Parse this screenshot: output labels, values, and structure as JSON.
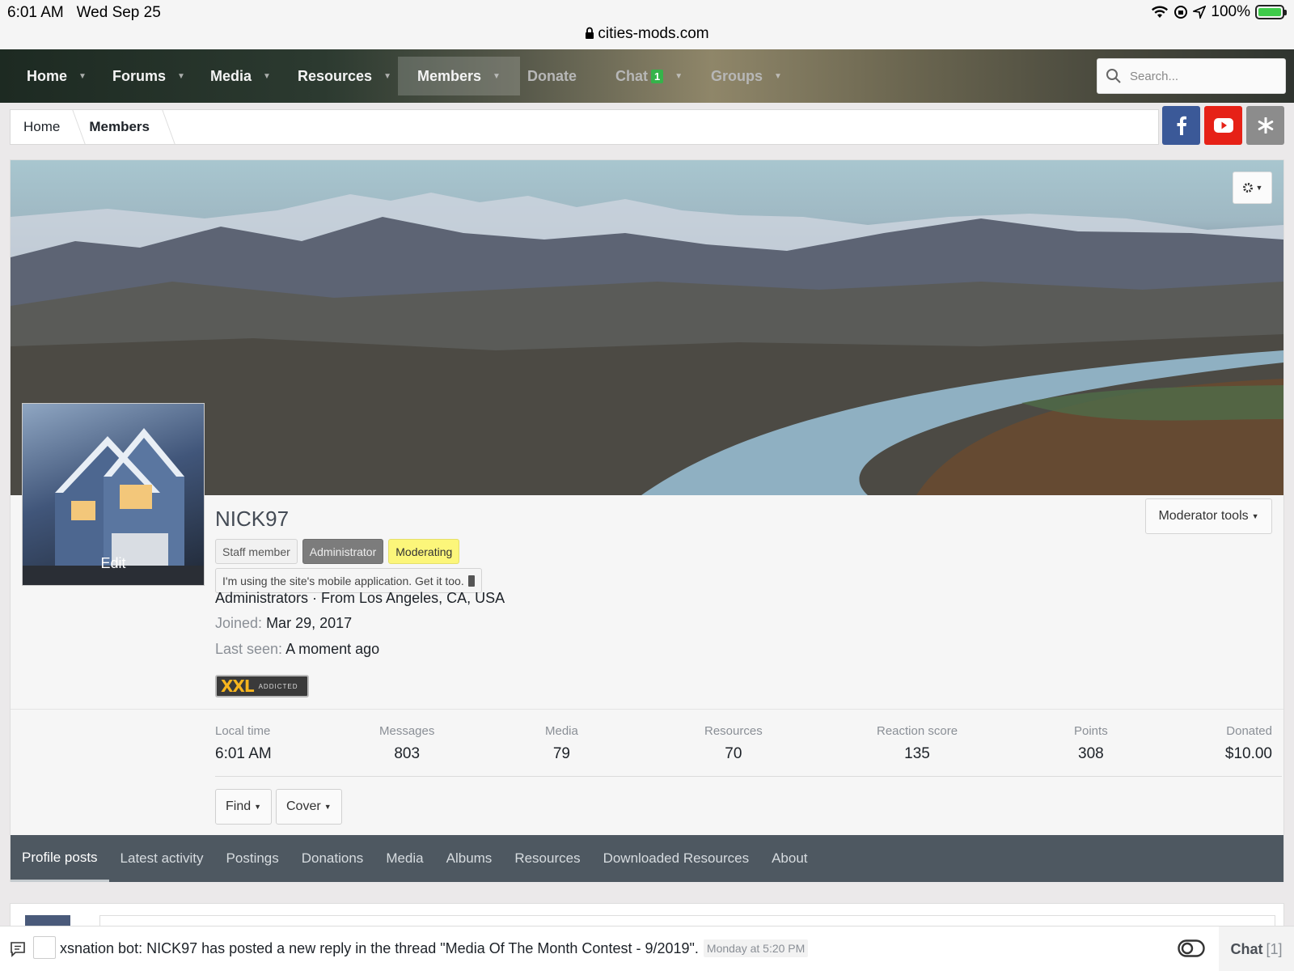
{
  "status_bar": {
    "time": "6:01 AM",
    "date": "Wed Sep 25",
    "battery": "100%",
    "url": "cities-mods.com"
  },
  "nav": {
    "items": [
      {
        "label": "Home"
      },
      {
        "label": "Forums"
      },
      {
        "label": "Media"
      },
      {
        "label": "Resources"
      },
      {
        "label": "Members"
      },
      {
        "label": "Donate"
      },
      {
        "label": "Chat",
        "badge": "1"
      },
      {
        "label": "Groups"
      }
    ],
    "search_placeholder": "Search..."
  },
  "breadcrumb": [
    "Home",
    "Members"
  ],
  "social": {
    "facebook_color": "#3b5998",
    "youtube_color": "#e62117",
    "other_color": "#8c8c8c"
  },
  "profile": {
    "avatar_edit": "Edit",
    "username": "NICK97",
    "badges": [
      "Staff member",
      "Administrator",
      "Moderating"
    ],
    "mobile_note": "I'm using the site's mobile application. Get it too.",
    "group_location": "Administrators · From Los Angeles, CA, USA",
    "joined_label": "Joined:",
    "joined_value": "Mar 29, 2017",
    "last_seen_label": "Last seen:",
    "last_seen_value": "A moment ago",
    "trophy_big": "XXL",
    "trophy_small": "ADDICTED",
    "moderator_tools": "Moderator tools"
  },
  "stats": [
    {
      "label": "Local time",
      "value": "6:01 AM"
    },
    {
      "label": "Messages",
      "value": "803"
    },
    {
      "label": "Media",
      "value": "79"
    },
    {
      "label": "Resources",
      "value": "70"
    },
    {
      "label": "Reaction score",
      "value": "135"
    },
    {
      "label": "Points",
      "value": "308"
    },
    {
      "label": "Donated",
      "value": "$10.00"
    }
  ],
  "buttons": {
    "find": "Find",
    "cover": "Cover"
  },
  "tabs": [
    "Profile posts",
    "Latest activity",
    "Postings",
    "Donations",
    "Media",
    "Albums",
    "Resources",
    "Downloaded Resources",
    "About"
  ],
  "chatbar": {
    "message": "xsnation bot: NICK97 has posted a new reply in the thread \"Media Of The Month Contest - 9/2019\".",
    "time": "Monday at 5:20 PM",
    "chat_label": "Chat",
    "chat_count": "[1]"
  }
}
